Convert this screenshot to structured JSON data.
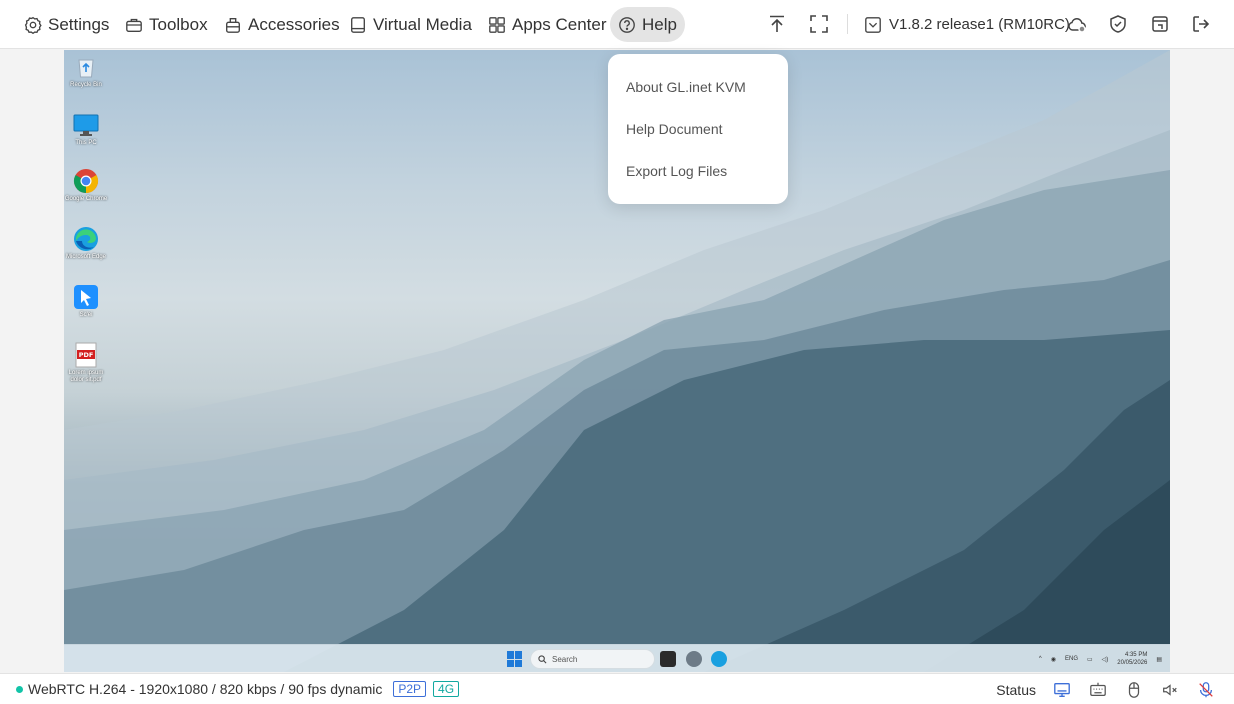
{
  "nav": {
    "items": [
      {
        "label": "Settings",
        "icon": "settings-icon"
      },
      {
        "label": "Toolbox",
        "icon": "toolbox-icon"
      },
      {
        "label": "Accessories",
        "icon": "accessories-icon"
      },
      {
        "label": "Virtual Media",
        "icon": "virtual-media-icon"
      },
      {
        "label": "Apps Center",
        "icon": "apps-center-icon"
      },
      {
        "label": "Help",
        "icon": "help-icon",
        "active": true
      }
    ],
    "version": "V1.8.2 release1 (RM10RC)"
  },
  "help_menu": {
    "items": [
      "About GL.inet KVM",
      "Help Document",
      "Export Log Files"
    ]
  },
  "desktop": {
    "icons": [
      {
        "label": "Recycle Bin",
        "icon": "recycle-bin-icon"
      },
      {
        "label": "This PC",
        "icon": "this-pc-icon"
      },
      {
        "label": "Google Chrome",
        "icon": "chrome-icon"
      },
      {
        "label": "Microsoft Edge",
        "icon": "edge-icon"
      },
      {
        "label": "Sc'ei",
        "icon": "app-shortcut-icon"
      },
      {
        "label": "Lorem ipsum dolor sit.pdf",
        "icon": "pdf-icon"
      }
    ],
    "taskbar": {
      "search_placeholder": "Search",
      "tray_lang": "ENG",
      "clock_time": "4:35 PM",
      "clock_date": "20/05/2026"
    }
  },
  "status": {
    "stream": "WebRTC H.264 - 1920x1080 /  820 kbps / 90 fps dynamic",
    "badge_p2p": "P2P",
    "badge_4g": "4G",
    "status_label": "Status",
    "colors": {
      "online": "#12c4a8",
      "p2p": "#3d6fd8",
      "4g": "#12a8a0"
    }
  }
}
